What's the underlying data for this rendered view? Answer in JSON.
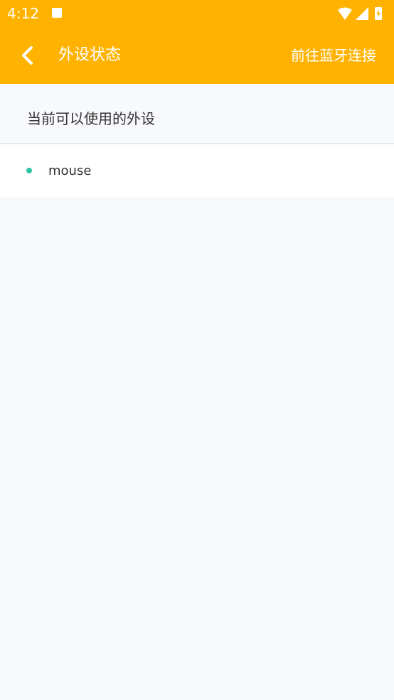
{
  "status_bar": {
    "time": "4:12"
  },
  "app_bar": {
    "title": "外设状态",
    "action": "前往蓝牙连接"
  },
  "section": {
    "label": "当前可以使用的外设"
  },
  "devices": [
    {
      "name": "mouse"
    }
  ],
  "colors": {
    "primary": "#ffb300",
    "dot": "#2ec4a4",
    "background": "#f8f9fc"
  },
  "icons": [
    "back-arrow-icon",
    "wifi-icon",
    "signal-icon",
    "battery-icon",
    "notification-icon"
  ]
}
